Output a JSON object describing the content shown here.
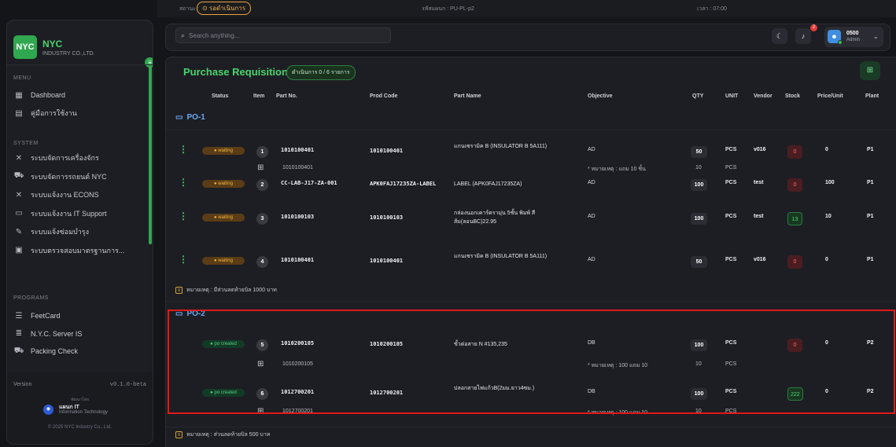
{
  "top_strip": {
    "status_label": "สถานะ :",
    "status_badge": "⊙ รอดำเนินการ",
    "code_label": "รหัสแผนก : PU-PL-p2",
    "time_label": "เวลา : 07:00"
  },
  "sidebar": {
    "logo": "NYC",
    "brand": "NYC",
    "brand_sub": "INDUSTRY CO.,LTD.",
    "menu_section": "MENU",
    "menu": [
      {
        "icon": "dashboard-icon",
        "glyph": "▦",
        "label": "Dashboard"
      },
      {
        "icon": "book-icon",
        "glyph": "▤",
        "label": "คู่มือการใช้งาน"
      }
    ],
    "system_section": "SYSTEM",
    "system": [
      {
        "icon": "tools-icon",
        "glyph": "✕",
        "label": "ระบบจัดการเครื่องจักร"
      },
      {
        "icon": "car-icon",
        "glyph": "⛟",
        "label": "ระบบจัดการรถยนต์ NYC"
      },
      {
        "icon": "tools-icon",
        "glyph": "✕",
        "label": "ระบบแจ้งงาน ECONS"
      },
      {
        "icon": "monitor-icon",
        "glyph": "▭",
        "label": "ระบบแจ้งงาน IT Support"
      },
      {
        "icon": "wrench-icon",
        "glyph": "✎",
        "label": "ระบบแจ้งซ่อมบำรุง"
      },
      {
        "icon": "clipboard-icon",
        "glyph": "▣",
        "label": "ระบบตรวจสอบมาตรฐานการ..."
      }
    ],
    "programs_section": "PROGRAMS",
    "programs": [
      {
        "icon": "list-icon",
        "glyph": "☰",
        "label": "FeetCard"
      },
      {
        "icon": "server-icon",
        "glyph": "≣",
        "label": "N.Y.C. Server IS"
      },
      {
        "icon": "truck-icon",
        "glyph": "⛟",
        "label": "Packing Check"
      }
    ],
    "version_label": "Version",
    "version": "v0.1.0-beta",
    "developed_by": "พัฒนาโดย",
    "it_name": "แผนก IT",
    "it_sub": "Information Technology",
    "copyright": "© 2025 NYC Industry Co., Ltd."
  },
  "topbar": {
    "search_placeholder": "Search anything...",
    "notif_count": "2",
    "user_name": "0500",
    "user_role": "Admin"
  },
  "page": {
    "title": "Purchase Requisition",
    "badge": "ดำเนินการ 0 / 6 รายการ"
  },
  "table": {
    "headers": {
      "status": "Status",
      "item": "Item",
      "part_no": "Part No.",
      "prod_code": "Prod Code",
      "part_name": "Part Name",
      "objective": "Objective",
      "qty": "QTY",
      "unit": "UNIT",
      "vendor": "Vendor",
      "stock": "Stock",
      "price": "Price/Unit",
      "plant": "Plant"
    },
    "groups": [
      {
        "name": "PO-1",
        "note": "หมายเหตุ : มีส่วนลดท้ายบิล 1000 บาท"
      },
      {
        "name": "PO-2",
        "note": "หมายเหตุ : ส่วนลดท้ายบิล 500 บาท"
      }
    ],
    "rows": [
      {
        "status": "● waiting",
        "item": "1",
        "part_no": "1010100401",
        "prod_code": "1010100401",
        "part_name": "แกนเซรามิค B (INSULATOR B 5A111)",
        "objective": "AD",
        "qty": "50",
        "unit": "PCS",
        "vendor": "v016",
        "stock": "0",
        "price": "0",
        "plant": "P1"
      },
      {
        "status": "● waiting",
        "item": "2",
        "part_no": "CC-LAB-J17-ZA-001",
        "prod_code": "APK0FAJ17235ZA-LABEL",
        "part_name": "LABEL (APK0FAJ17235ZA)",
        "objective": "AD",
        "qty": "100",
        "unit": "PCS",
        "vendor": "test",
        "stock": "0",
        "price": "100",
        "plant": "P1"
      },
      {
        "status": "● waiting",
        "item": "3",
        "part_no": "1010100103",
        "prod_code": "1010100103",
        "part_name": "กล่องนอกเคาร์ตรามุ่น 5ชั้น พิมพ์ สีส้ม(ลอนBC)22.95",
        "objective": "AD",
        "qty": "100",
        "unit": "PCS",
        "vendor": "test",
        "stock": "13",
        "price": "10",
        "plant": "P1"
      },
      {
        "status": "● waiting",
        "item": "4",
        "part_no": "1010100401",
        "prod_code": "1010100401",
        "part_name": "แกนเซรามิค B (INSULATOR B 5A111)",
        "objective": "AD",
        "qty": "50",
        "unit": "PCS",
        "vendor": "v016",
        "stock": "0",
        "price": "0",
        "plant": "P1"
      },
      {
        "status": "● po created",
        "item": "5",
        "part_no": "1010200105",
        "prod_code": "1010200105",
        "part_name": "ขั้วต่อสาย N #135,235",
        "objective": "DB",
        "qty": "100",
        "unit": "PCS",
        "vendor": "",
        "stock": "0",
        "price": "0",
        "plant": "P2"
      },
      {
        "status": "● po created",
        "item": "6",
        "part_no": "1012700201",
        "prod_code": "1012700201",
        "part_name": "ปลอกสายไฟแก้วB(2มม.ยาว4ซม.)",
        "objective": "DB",
        "qty": "100",
        "unit": "PCS",
        "vendor": "",
        "stock": "222",
        "price": "0",
        "plant": "P2"
      }
    ],
    "subrows": [
      {
        "part_no": "1010100401",
        "objective": "* หมายเหตุ : แถม 10 ชิ้น",
        "qty": "10",
        "unit": "PCS"
      },
      {
        "part_no": "1010200105",
        "objective": "* หมายเหตุ : 100 แถม 10",
        "qty": "10",
        "unit": "PCS"
      },
      {
        "part_no": "1012700201",
        "objective": "* หมายเหตุ : 100 แถม 10",
        "qty": "10",
        "unit": "PCS"
      }
    ]
  }
}
